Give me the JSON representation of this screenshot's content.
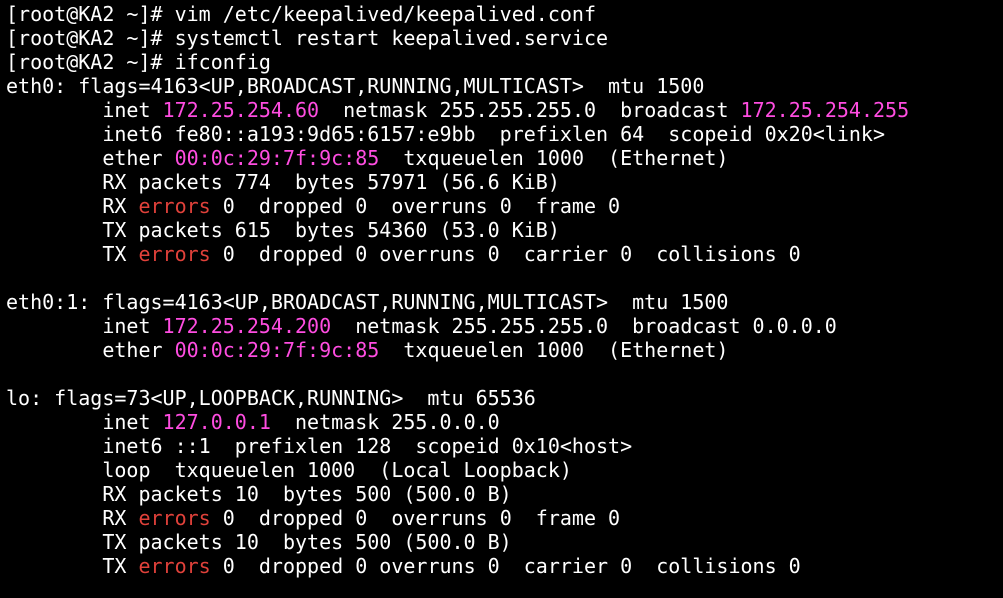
{
  "theme": {
    "background": "#000000",
    "foreground": "#ffffff",
    "highlight_magenta": "#ff4de1",
    "error_red": "#e0413a"
  },
  "lines": [
    {
      "segments": [
        {
          "text": "[root@KA2 ~]# vim /etc/keepalived/keepalived.conf",
          "cls": "",
          "name": "shell-prompt-command"
        }
      ]
    },
    {
      "segments": [
        {
          "text": "[root@KA2 ~]# systemctl restart keepalived.service",
          "cls": "",
          "name": "shell-prompt-command"
        }
      ]
    },
    {
      "segments": [
        {
          "text": "[root@KA2 ~]# ifconfig",
          "cls": "",
          "name": "shell-prompt-command"
        }
      ]
    },
    {
      "segments": [
        {
          "text": "eth0: flags=4163<UP,BROADCAST,RUNNING,MULTICAST>  mtu 1500",
          "cls": "",
          "name": "interface-header-eth0"
        }
      ]
    },
    {
      "segments": [
        {
          "text": "        inet ",
          "cls": "",
          "name": "output-text"
        },
        {
          "text": "172.25.254.60",
          "cls": "ip",
          "name": "ip-address"
        },
        {
          "text": "  netmask 255.255.255.0  broadcast ",
          "cls": "",
          "name": "output-text"
        },
        {
          "text": "172.25.254.255",
          "cls": "ip",
          "name": "ip-address"
        }
      ]
    },
    {
      "segments": [
        {
          "text": "        inet6 fe80::a193:9d65:6157:e9bb  prefixlen 64  scopeid 0x20<link>",
          "cls": "",
          "name": "output-text"
        }
      ]
    },
    {
      "segments": [
        {
          "text": "        ether ",
          "cls": "",
          "name": "output-text"
        },
        {
          "text": "00:0c:29:7f:9c:85",
          "cls": "mac",
          "name": "mac-address"
        },
        {
          "text": "  txqueuelen 1000  (Ethernet)",
          "cls": "",
          "name": "output-text"
        }
      ]
    },
    {
      "segments": [
        {
          "text": "        RX packets 774  bytes 57971 (56.6 KiB)",
          "cls": "",
          "name": "output-text"
        }
      ]
    },
    {
      "segments": [
        {
          "text": "        RX ",
          "cls": "",
          "name": "output-text"
        },
        {
          "text": "errors",
          "cls": "err",
          "name": "errors-label"
        },
        {
          "text": " 0  dropped 0  overruns 0  frame 0",
          "cls": "",
          "name": "output-text"
        }
      ]
    },
    {
      "segments": [
        {
          "text": "        TX packets 615  bytes 54360 (53.0 KiB)",
          "cls": "",
          "name": "output-text"
        }
      ]
    },
    {
      "segments": [
        {
          "text": "        TX ",
          "cls": "",
          "name": "output-text"
        },
        {
          "text": "errors",
          "cls": "err",
          "name": "errors-label"
        },
        {
          "text": " 0  dropped 0 overruns 0  carrier 0  collisions 0",
          "cls": "",
          "name": "output-text"
        }
      ]
    },
    {
      "segments": [
        {
          "text": "",
          "cls": "",
          "name": "blank-line"
        }
      ]
    },
    {
      "segments": [
        {
          "text": "eth0:1: flags=4163<UP,BROADCAST,RUNNING,MULTICAST>  mtu 1500",
          "cls": "",
          "name": "interface-header-eth0-1"
        }
      ]
    },
    {
      "segments": [
        {
          "text": "        inet ",
          "cls": "",
          "name": "output-text"
        },
        {
          "text": "172.25.254.200",
          "cls": "ip",
          "name": "ip-address"
        },
        {
          "text": "  netmask 255.255.255.0  broadcast 0.0.0.0",
          "cls": "",
          "name": "output-text"
        }
      ]
    },
    {
      "segments": [
        {
          "text": "        ether ",
          "cls": "",
          "name": "output-text"
        },
        {
          "text": "00:0c:29:7f:9c:85",
          "cls": "mac",
          "name": "mac-address"
        },
        {
          "text": "  txqueuelen 1000  (Ethernet)",
          "cls": "",
          "name": "output-text"
        }
      ]
    },
    {
      "segments": [
        {
          "text": "",
          "cls": "",
          "name": "blank-line"
        }
      ]
    },
    {
      "segments": [
        {
          "text": "lo: flags=73<UP,LOOPBACK,RUNNING>  mtu 65536",
          "cls": "",
          "name": "interface-header-lo"
        }
      ]
    },
    {
      "segments": [
        {
          "text": "        inet ",
          "cls": "",
          "name": "output-text"
        },
        {
          "text": "127.0.0.1",
          "cls": "ip",
          "name": "ip-address"
        },
        {
          "text": "  netmask 255.0.0.0",
          "cls": "",
          "name": "output-text"
        }
      ]
    },
    {
      "segments": [
        {
          "text": "        inet6 ::1  prefixlen 128  scopeid 0x10<host>",
          "cls": "",
          "name": "output-text"
        }
      ]
    },
    {
      "segments": [
        {
          "text": "        loop  txqueuelen 1000  (Local Loopback)",
          "cls": "",
          "name": "output-text"
        }
      ]
    },
    {
      "segments": [
        {
          "text": "        RX packets 10  bytes 500 (500.0 B)",
          "cls": "",
          "name": "output-text"
        }
      ]
    },
    {
      "segments": [
        {
          "text": "        RX ",
          "cls": "",
          "name": "output-text"
        },
        {
          "text": "errors",
          "cls": "err",
          "name": "errors-label"
        },
        {
          "text": " 0  dropped 0  overruns 0  frame 0",
          "cls": "",
          "name": "output-text"
        }
      ]
    },
    {
      "segments": [
        {
          "text": "        TX packets 10  bytes 500 (500.0 B)",
          "cls": "",
          "name": "output-text"
        }
      ]
    },
    {
      "segments": [
        {
          "text": "        TX ",
          "cls": "",
          "name": "output-text"
        },
        {
          "text": "errors",
          "cls": "err",
          "name": "errors-label"
        },
        {
          "text": " 0  dropped 0 overruns 0  carrier 0  collisions 0",
          "cls": "",
          "name": "output-text"
        }
      ]
    }
  ]
}
